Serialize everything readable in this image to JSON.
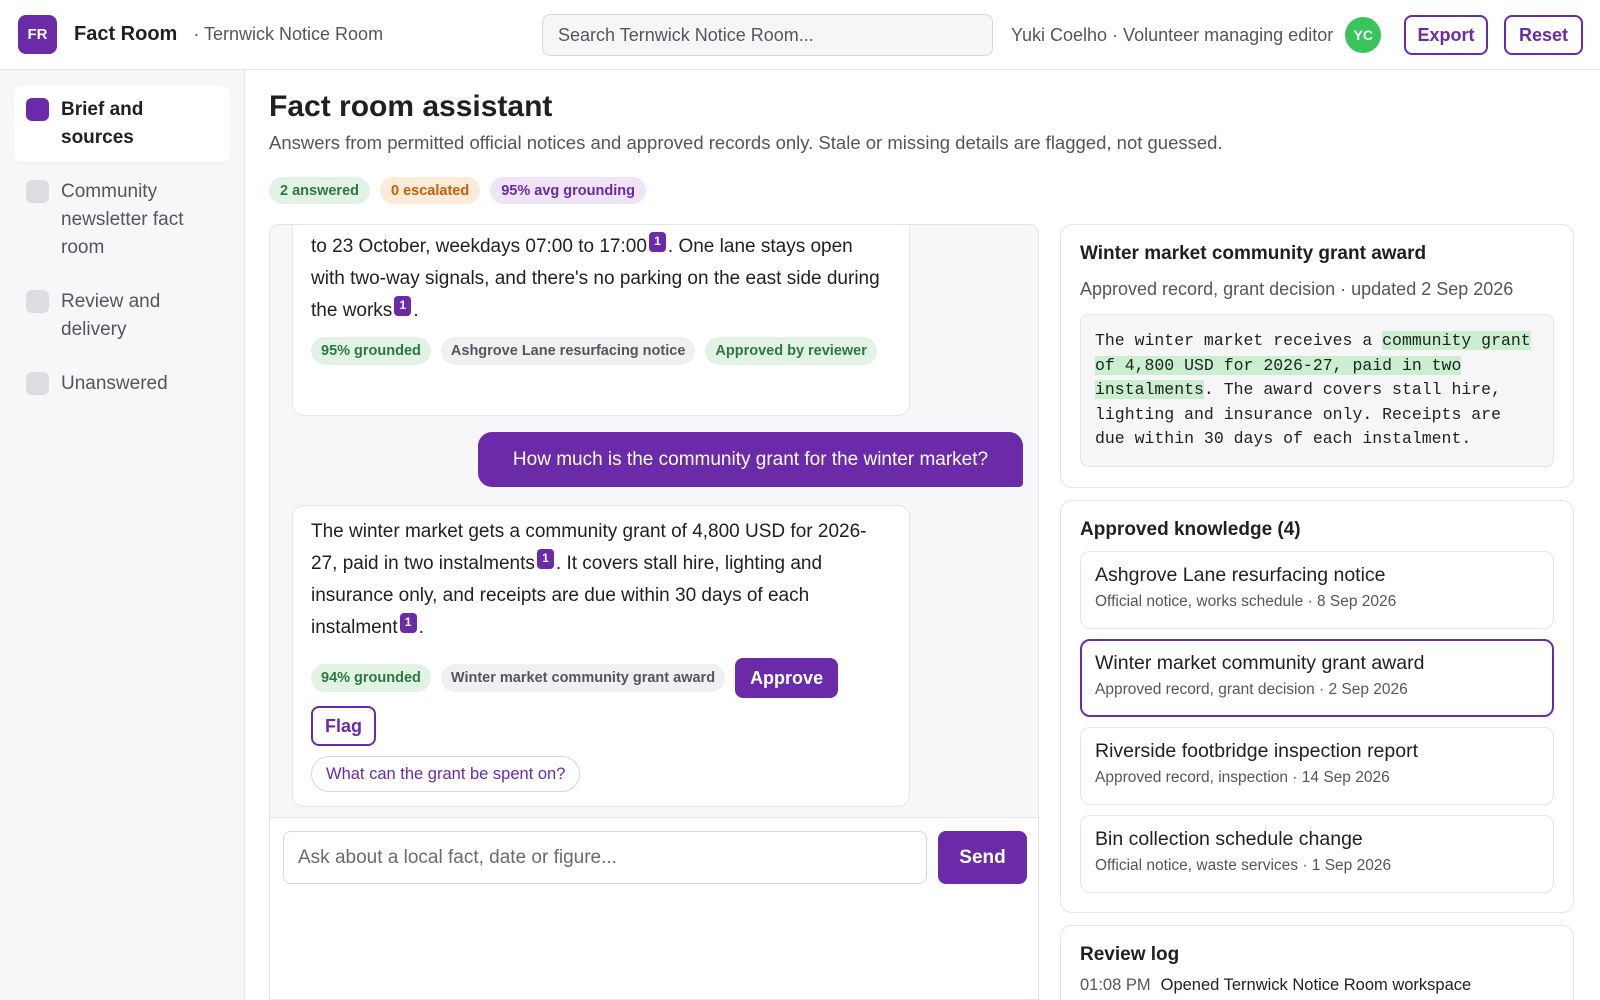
{
  "app": {
    "logo_text": "FR",
    "name": "Fact Room",
    "workspace": "· Ternwick Notice Room"
  },
  "search": {
    "placeholder": "Search Ternwick Notice Room..."
  },
  "user": {
    "label": "Yuki Coelho · Volunteer managing editor",
    "initials": "YC"
  },
  "header_actions": {
    "export_label": "Export",
    "reset_label": "Reset"
  },
  "sidebar": {
    "items": [
      {
        "label": "Brief and sources",
        "active": true
      },
      {
        "label": "Community newsletter fact room",
        "active": false
      },
      {
        "label": "Review and delivery",
        "active": false
      },
      {
        "label": "Unanswered",
        "active": false
      }
    ]
  },
  "main": {
    "title": "Fact room assistant",
    "subtitle": "Answers from permitted official notices and approved records only. Stale or missing details are flagged, not guessed.",
    "stats": {
      "answered": "2 answered",
      "escalated": "0 escalated",
      "grounding": "95% avg grounding"
    }
  },
  "chat": {
    "messages": [
      {
        "role": "assistant",
        "text_parts": [
          "to 23 October, weekdays 07:00 to 17:00",
          ". One lane stays open with two-way signals, and there's no parking on the east side during the works",
          "."
        ],
        "citations": [
          "1",
          "1"
        ],
        "grounded": "95% grounded",
        "source": "Ashgrove Lane resurfacing notice",
        "status": "Approved by reviewer"
      },
      {
        "role": "user",
        "text": "How much is the community grant for the winter market?"
      },
      {
        "role": "assistant",
        "text_parts": [
          "The winter market gets a community grant of 4,800 USD for 2026-27, paid in two instalments",
          ". It covers stall hire, lighting and insurance only, and receipts are due within 30 days of each instalment",
          "."
        ],
        "citations": [
          "1",
          "1"
        ],
        "grounded": "94% grounded",
        "source": "Winter market community grant award",
        "approve_label": "Approve",
        "flag_label": "Flag",
        "suggestion": "What can the grant be spent on?"
      }
    ],
    "composer": {
      "placeholder": "Ask about a local fact, date or figure...",
      "send_label": "Send"
    }
  },
  "source_detail": {
    "title": "Winter market community grant award",
    "meta": "Approved record, grant decision · updated 2 Sep 2026",
    "excerpt_before": "The winter market receives a ",
    "excerpt_highlight": "community grant of 4,800 USD for 2026-27, paid in two instalments",
    "excerpt_after": ". The award covers stall hire, lighting and insurance only. Receipts are due within 30 days of each instalment."
  },
  "knowledge": {
    "title": "Approved knowledge (4)",
    "items": [
      {
        "name": "Ashgrove Lane resurfacing notice",
        "meta": "Official notice, works schedule · 8 Sep 2026",
        "selected": false
      },
      {
        "name": "Winter market community grant award",
        "meta": "Approved record, grant decision · 2 Sep 2026",
        "selected": true
      },
      {
        "name": "Riverside footbridge inspection report",
        "meta": "Approved record, inspection · 14 Sep 2026",
        "selected": false
      },
      {
        "name": "Bin collection schedule change",
        "meta": "Official notice, waste services · 1 Sep 2026",
        "selected": false
      }
    ]
  },
  "review_log": {
    "title": "Review log",
    "entries": [
      {
        "time": "01:08 PM",
        "text": "Opened Ternwick Notice Room workspace"
      }
    ]
  },
  "colors": {
    "accent": "#6b2aa8",
    "avatar": "#3ac45c",
    "grounded_bg": "#e2f3e6",
    "escalated_bg": "#fcebd9",
    "highlight": "#c9efcf"
  }
}
